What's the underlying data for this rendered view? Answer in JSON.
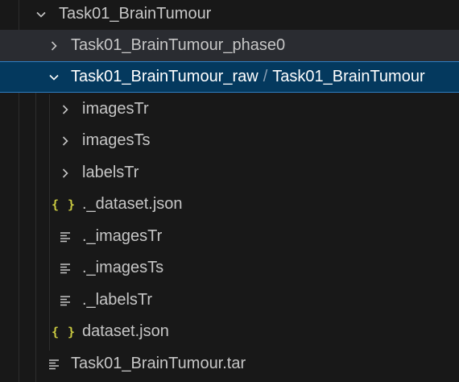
{
  "explorer": {
    "items": [
      {
        "label": "Task01_BrainTumour",
        "icon": "chevron-down-icon"
      },
      {
        "label": "Task01_BrainTumour_phase0",
        "icon": "chevron-right-icon"
      },
      {
        "label_a": "Task01_BrainTumour_raw",
        "separator": "/",
        "label_b": "Task01_BrainTumour",
        "icon": "chevron-down-icon"
      },
      {
        "label": "imagesTr",
        "icon": "chevron-right-icon"
      },
      {
        "label": "imagesTs",
        "icon": "chevron-right-icon"
      },
      {
        "label": "labelsTr",
        "icon": "chevron-right-icon"
      },
      {
        "label": "._dataset.json",
        "icon": "json-icon",
        "icon_text": "{ }"
      },
      {
        "label": "._imagesTr",
        "icon": "text-file-icon"
      },
      {
        "label": "._imagesTs",
        "icon": "text-file-icon"
      },
      {
        "label": "._labelsTr",
        "icon": "text-file-icon"
      },
      {
        "label": "dataset.json",
        "icon": "json-icon",
        "icon_text": "{ }"
      },
      {
        "label": "Task01_BrainTumour.tar",
        "icon": "text-file-icon"
      }
    ]
  },
  "colors": {
    "background": "#181818",
    "selected_background": "#04395e",
    "selected_border": "#2f7fc4",
    "json_icon": "#cbcb41",
    "text": "#c6c6c6"
  }
}
